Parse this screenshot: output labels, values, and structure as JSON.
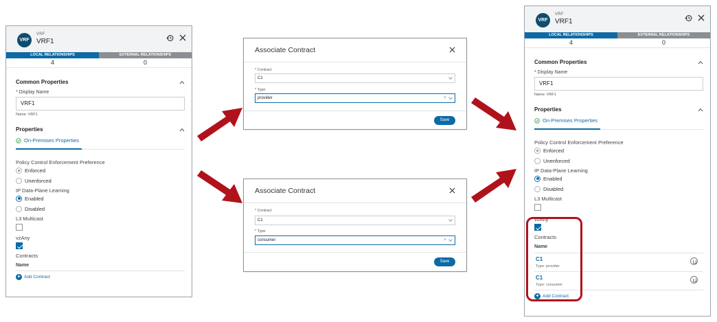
{
  "colors": {
    "accent": "#0d6aa4",
    "badge": "#0f4c6e",
    "arrow": "#b0121b",
    "highlight": "#b0121b"
  },
  "vrf_panel": {
    "badge": "VRF",
    "kind": "VRF",
    "name": "VRF1",
    "tabs": [
      {
        "label": "LOCAL RELATIONSHIPS",
        "count": "4"
      },
      {
        "label": "EXTERNAL RELATIONSHIPS",
        "count": "0"
      }
    ],
    "common_properties": "Common Properties",
    "display_name_label": "* Display Name",
    "display_name_value": "VRF1",
    "name_hint": "Name: VRF1",
    "properties": "Properties",
    "on_premises": "On-Premises Properties",
    "policy_label": "Policy Control Enforcement Preference",
    "policy_options": [
      "Enforced",
      "Unenforced"
    ],
    "ip_label": "IP Data-Plane Learning",
    "ip_options": [
      "Enabled",
      "Disabled"
    ],
    "l3_label": "L3 Multicast",
    "vzany_label": "vzAny",
    "contracts_label": "Contracts",
    "name_header": "Name",
    "add_contract": "Add Contract",
    "contracts": [
      {
        "name": "C1",
        "type": "Type: provider"
      },
      {
        "name": "C1",
        "type": "Type: consumer"
      }
    ]
  },
  "dialogs": [
    {
      "title": "Associate Contract",
      "contract_label": "* Contract",
      "contract_value": "C1",
      "type_label": "* Type",
      "type_value": "provider",
      "save": "Save"
    },
    {
      "title": "Associate Contract",
      "contract_label": "* Contract",
      "contract_value": "C1",
      "type_label": "* Type",
      "type_value": "consumer",
      "save": "Save"
    }
  ]
}
